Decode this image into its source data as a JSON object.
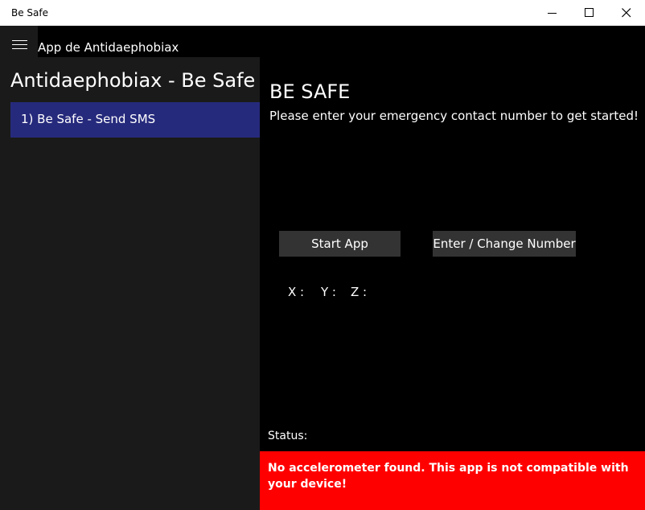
{
  "window": {
    "title": "Be Safe",
    "controls": [
      "minimize-icon",
      "maximize-icon",
      "close-icon"
    ]
  },
  "header": {
    "menu_icon": "hamburger-icon",
    "title": "App de Antidaephobiax"
  },
  "sidebar": {
    "title": "Antidaephobiax - Be Safe",
    "items": [
      {
        "label": "1) Be Safe - Send SMS",
        "selected": true
      }
    ]
  },
  "main": {
    "title": "BE SAFE",
    "subtitle": "Please enter your emergency contact number to get started!",
    "buttons": {
      "start": "Start App",
      "change_number": "Enter / Change Number"
    },
    "axes": {
      "x": "X :",
      "y": "Y :",
      "z": "Z :"
    },
    "status_label": "Status:",
    "status_message": "No accelerometer found. This app is not compatible with your device!"
  },
  "colors": {
    "titlebar": "#ffffff",
    "background": "#000000",
    "sidebar": "#1a1a1a",
    "selected_item": "#262a7c",
    "button": "#333333",
    "error": "#ff0000"
  }
}
